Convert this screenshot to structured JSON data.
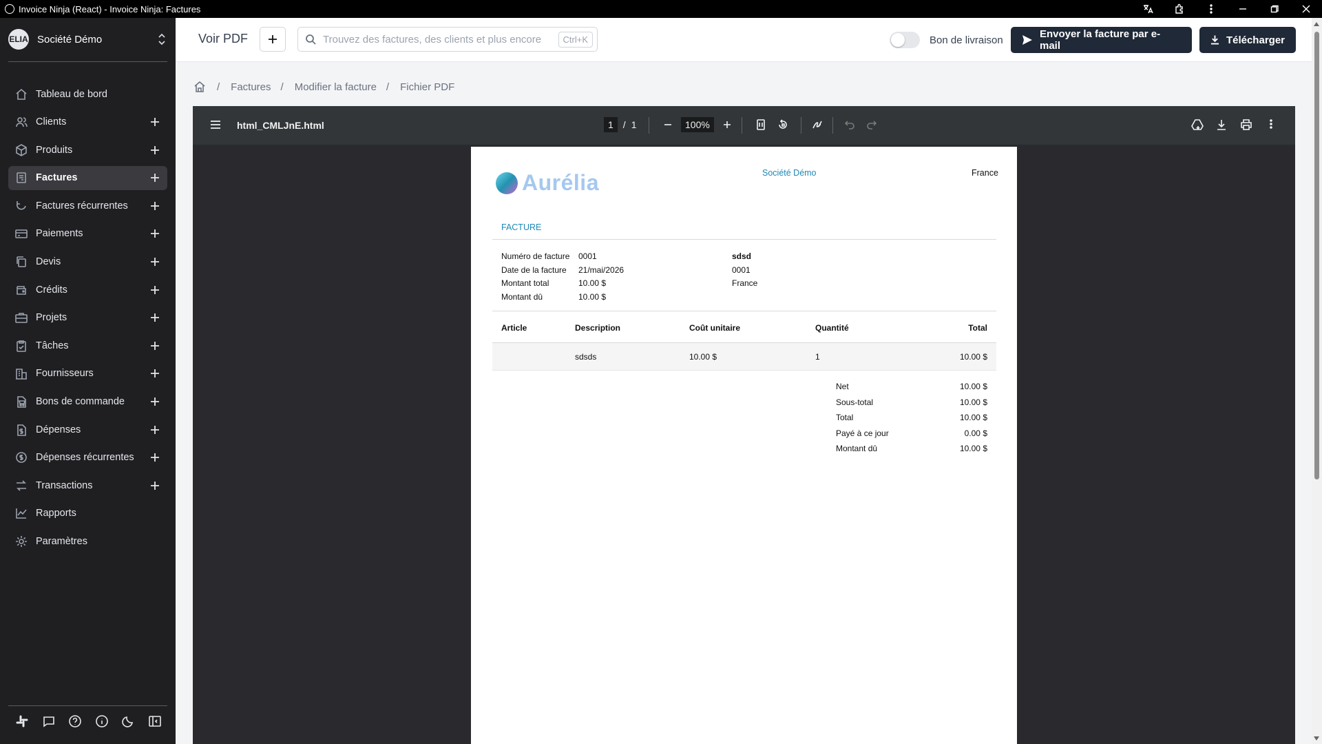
{
  "window": {
    "title": "Invoice Ninja (React) - Invoice Ninja: Factures"
  },
  "sidebar": {
    "company_logo": "ELIA",
    "company_name": "Société Démo",
    "items": [
      {
        "label": "Tableau de bord",
        "icon": "home-icon",
        "plus": false,
        "active": false
      },
      {
        "label": "Clients",
        "icon": "users-icon",
        "plus": true,
        "active": false
      },
      {
        "label": "Produits",
        "icon": "package-icon",
        "plus": true,
        "active": false
      },
      {
        "label": "Factures",
        "icon": "file-invoice-icon",
        "plus": true,
        "active": true
      },
      {
        "label": "Factures récurrentes",
        "icon": "refresh-icon",
        "plus": true,
        "active": false
      },
      {
        "label": "Paiements",
        "icon": "credit-card-icon",
        "plus": true,
        "active": false
      },
      {
        "label": "Devis",
        "icon": "copy-icon",
        "plus": true,
        "active": false
      },
      {
        "label": "Crédits",
        "icon": "wallet-icon",
        "plus": true,
        "active": false
      },
      {
        "label": "Projets",
        "icon": "briefcase-icon",
        "plus": true,
        "active": false
      },
      {
        "label": "Tâches",
        "icon": "clipboard-check-icon",
        "plus": true,
        "active": false
      },
      {
        "label": "Fournisseurs",
        "icon": "building-icon",
        "plus": true,
        "active": false
      },
      {
        "label": "Bons de commande",
        "icon": "file-cart-icon",
        "plus": true,
        "active": false
      },
      {
        "label": "Dépenses",
        "icon": "file-dollar-icon",
        "plus": true,
        "active": false
      },
      {
        "label": "Dépenses récurrentes",
        "icon": "refresh-dollar-icon",
        "plus": true,
        "active": false
      },
      {
        "label": "Transactions",
        "icon": "transactions-icon",
        "plus": true,
        "active": false
      },
      {
        "label": "Rapports",
        "icon": "chart-line-icon",
        "plus": false,
        "active": false
      },
      {
        "label": "Paramètres",
        "icon": "settings-icon",
        "plus": false,
        "active": false
      }
    ]
  },
  "header": {
    "title": "Voir PDF",
    "search_placeholder": "Trouvez des factures, des clients et plus encore",
    "search_shortcut": "Ctrl+K",
    "toggle_label": "Bon de livraison",
    "toggle_on": false,
    "send_label": "Envoyer la facture par e-mail",
    "download_label": "Télécharger"
  },
  "breadcrumb": [
    "Factures",
    "Modifier la facture",
    "Fichier PDF"
  ],
  "viewer": {
    "filename": "html_CMLJnE.html",
    "page_current": "1",
    "page_sep": "/",
    "page_total": "1",
    "zoom": "100%"
  },
  "invoice": {
    "brand": "Aurélia",
    "company": "Société Démo",
    "country": "France",
    "heading": "FACTURE",
    "details": [
      {
        "label": "Numéro de facture",
        "value": "0001"
      },
      {
        "label": "Date de la facture",
        "value": "21/mai/2026"
      },
      {
        "label": "Montant total",
        "value": "10.00 $"
      },
      {
        "label": "Montant dû",
        "value": "10.00 $"
      }
    ],
    "client": {
      "name": "sdsd",
      "number": "0001",
      "country": "France"
    },
    "columns": {
      "article": "Article",
      "description": "Description",
      "unit_cost": "Coût unitaire",
      "quantity": "Quantité",
      "total": "Total"
    },
    "rows": [
      {
        "article": "",
        "description": "sdsds",
        "unit_cost": "10.00 $",
        "quantity": "1",
        "total": "10.00 $"
      }
    ],
    "totals": [
      {
        "label": "Net",
        "value": "10.00 $"
      },
      {
        "label": "Sous-total",
        "value": "10.00 $"
      },
      {
        "label": "Total",
        "value": "10.00 $"
      },
      {
        "label": "Payé à ce jour",
        "value": "0.00 $"
      },
      {
        "label": "Montant dû",
        "value": "10.00 $"
      }
    ]
  }
}
